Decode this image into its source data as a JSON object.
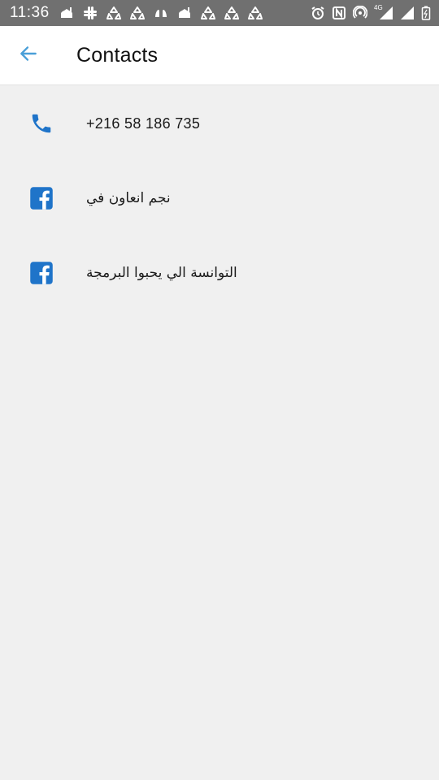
{
  "status_bar": {
    "time": "11:36",
    "notification_icons": [
      "mosque-icon",
      "slack-icon",
      "recycle-icon",
      "recycle-icon",
      "hands-icon",
      "mosque-icon",
      "recycle-icon",
      "recycle-icon",
      "recycle-icon"
    ],
    "system_icons": [
      "alarm-icon",
      "nfc-icon",
      "hotspot-icon",
      "signal-4g-icon",
      "signal-icon",
      "battery-icon"
    ],
    "network_label": "4G"
  },
  "header": {
    "back_icon": "arrow-left-icon",
    "title": "Contacts",
    "accent_color": "#4a9fd8"
  },
  "contacts": [
    {
      "icon": "phone-icon",
      "label": "+216 58 186 735",
      "rtl": false
    },
    {
      "icon": "facebook-icon",
      "label": "نجم انعاون في",
      "rtl": true
    },
    {
      "icon": "facebook-icon",
      "label": "التوانسة الي يحبوا البرمجة",
      "rtl": true
    }
  ],
  "colors": {
    "icon_blue": "#1f74c9",
    "background": "#f0f0f0",
    "status_bar": "#707070"
  }
}
